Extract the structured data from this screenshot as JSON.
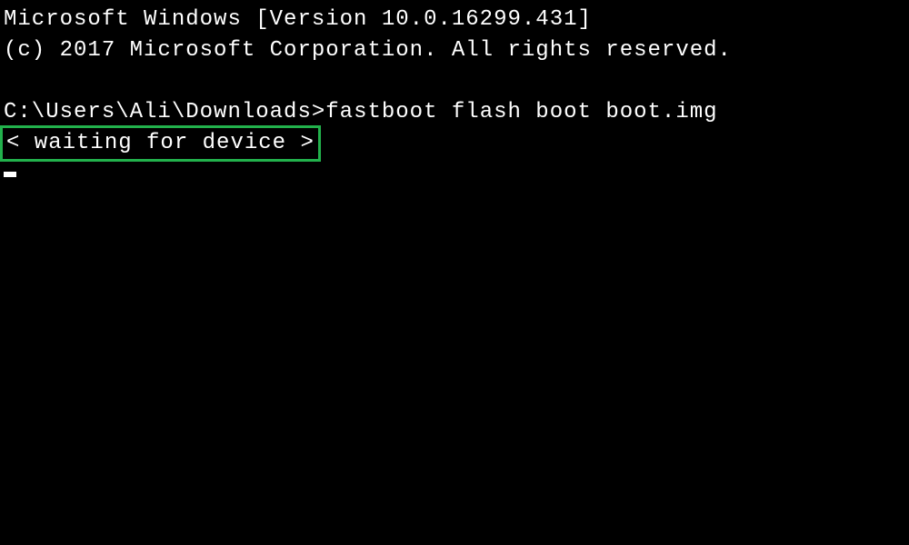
{
  "terminal": {
    "version_line": "Microsoft Windows [Version 10.0.16299.431]",
    "copyright_line": "(c) 2017 Microsoft Corporation. All rights reserved.",
    "prompt": "C:\\Users\\Ali\\Downloads>",
    "command": "fastboot flash boot boot.img",
    "status_message": "< waiting for device >"
  },
  "highlight_color": "#22b14c"
}
